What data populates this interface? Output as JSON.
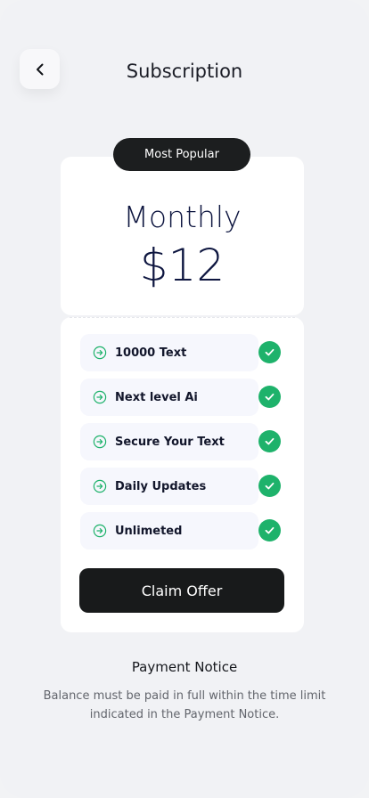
{
  "header": {
    "back_icon": "chevron-left-icon",
    "title": "Subscription"
  },
  "plan": {
    "badge": "Most Popular",
    "name": "Monthly",
    "price": "$12"
  },
  "features": {
    "items": [
      {
        "label": "10000 Text",
        "icon": "arrow-right-circle-icon",
        "included": true
      },
      {
        "label": "Next level Ai",
        "icon": "arrow-right-circle-icon",
        "included": true
      },
      {
        "label": "Secure Your Text",
        "icon": "arrow-right-circle-icon",
        "included": true
      },
      {
        "label": "Daily Updates",
        "icon": "arrow-right-circle-icon",
        "included": true
      },
      {
        "label": "Unlimeted",
        "icon": "arrow-right-circle-icon",
        "included": true
      }
    ],
    "check_icon": "check-circle-icon"
  },
  "cta": {
    "label": "Claim Offer"
  },
  "notice": {
    "title": "Payment Notice",
    "text": "Balance must be paid in full within the time limit indicated in the Payment Notice."
  },
  "colors": {
    "background": "#f1f2f5",
    "accent_green": "#1eb26b",
    "dark": "#181a1b",
    "navy_text": "#0e1640"
  }
}
